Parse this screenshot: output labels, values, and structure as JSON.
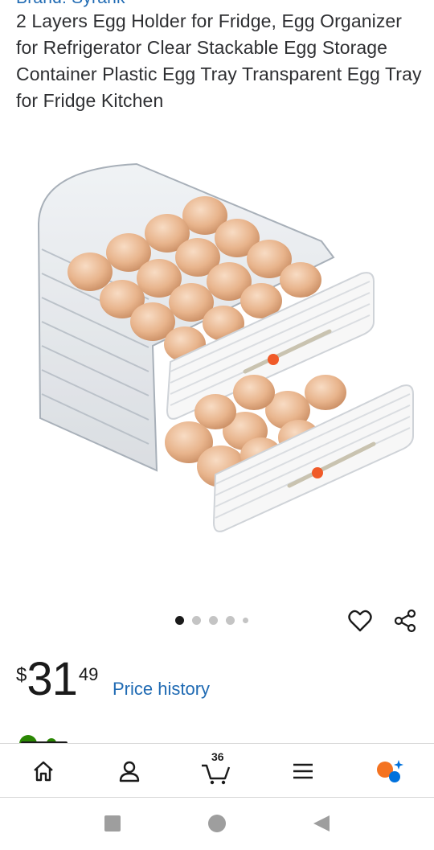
{
  "product": {
    "brand_line": "Brand: Syrank",
    "title": "2 Layers Egg Holder for Fridge, Egg Organizer for Refrigerator Clear Stackable Egg Storage Container Plastic Egg Tray Transparent Egg Tray for Fridge Kitchen"
  },
  "carousel": {
    "image_count": 5,
    "active_index": 0
  },
  "price": {
    "currency": "$",
    "dollars": "31",
    "cents": "49",
    "history_label": "Price history"
  },
  "bottom_nav": {
    "cart_count": "36",
    "items": [
      "home-icon",
      "account-icon",
      "cart-icon",
      "menu-icon",
      "assistant-icon"
    ]
  },
  "colors": {
    "link_blue": "#1f6ab3",
    "text_dark": "#2e2f32",
    "assistant_orange": "#f47321",
    "assistant_blue": "#0071dc",
    "slider_orange": "#f05a28"
  },
  "system_nav": [
    "recent-apps-icon",
    "home-circle-icon",
    "back-icon"
  ]
}
